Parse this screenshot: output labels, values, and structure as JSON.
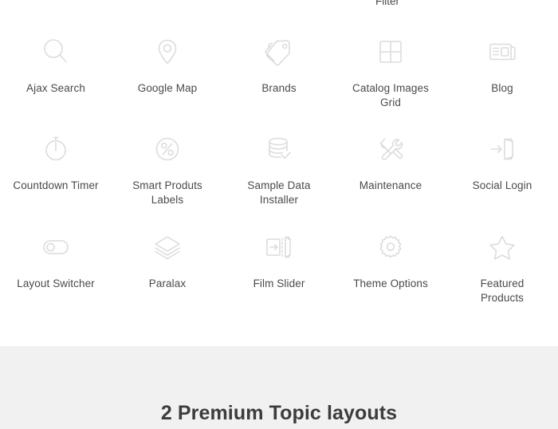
{
  "clipped_previous_row": {
    "label": "Filter"
  },
  "features": {
    "rows": [
      {
        "items": [
          {
            "label": "Ajax Search",
            "icon": "magnifier-icon"
          },
          {
            "label": "Google Map",
            "icon": "map-pin-icon"
          },
          {
            "label": "Brands",
            "icon": "price-tags-icon"
          },
          {
            "label": "Catalog Images Grid",
            "icon": "grid-icon"
          },
          {
            "label": "Blog",
            "icon": "newspaper-icon"
          }
        ]
      },
      {
        "items": [
          {
            "label": "Countdown Timer",
            "icon": "stopwatch-icon"
          },
          {
            "label": "Smart Produts Labels",
            "icon": "percent-circle-icon"
          },
          {
            "label": "Sample Data Installer",
            "icon": "database-check-icon"
          },
          {
            "label": "Maintenance",
            "icon": "tools-icon"
          },
          {
            "label": "Social Login",
            "icon": "login-door-icon"
          }
        ]
      },
      {
        "items": [
          {
            "label": "Layout Switcher",
            "icon": "toggle-switch-icon"
          },
          {
            "label": "Paralax",
            "icon": "layers-icon"
          },
          {
            "label": "Film Slider",
            "icon": "film-slider-icon"
          },
          {
            "label": "Theme Options",
            "icon": "gear-icon"
          },
          {
            "label": "Featured Products",
            "icon": "star-icon"
          }
        ]
      }
    ]
  },
  "banner": {
    "title": "2 Premium Topic layouts",
    "background_color": "#f1f1f1"
  },
  "colors": {
    "page_background": "#ffffff",
    "icon_stroke": "#dcdcdc",
    "label_text": "#4a4a4a",
    "heading_text": "#3c3c3c"
  }
}
